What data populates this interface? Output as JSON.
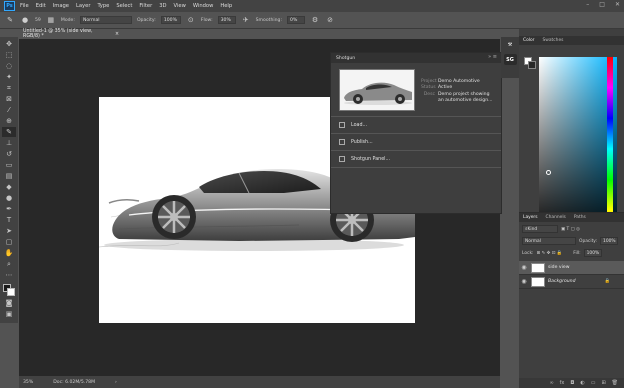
{
  "app": {
    "logo_text": "Ps"
  },
  "menu": [
    "File",
    "Edit",
    "Image",
    "Layer",
    "Type",
    "Select",
    "Filter",
    "3D",
    "View",
    "Window",
    "Help"
  ],
  "window_controls": {
    "minimize": "–",
    "maximize": "□",
    "close": "✕"
  },
  "options_bar": {
    "brush_size": "59",
    "mode_label": "Mode:",
    "mode_value": "Normal",
    "opacity_label": "Opacity:",
    "opacity_value": "100%",
    "flow_label": "Flow:",
    "flow_value": "30%",
    "smoothing_label": "Smoothing:",
    "smoothing_value": "0%"
  },
  "document": {
    "tab_title": "Untitled-1 @ 35% (side view, RGB/8) *",
    "tab_close": "×",
    "zoom": "35%",
    "doc_info": "Doc: 6.02M/5.78M"
  },
  "shotgun_panel": {
    "title": "Shotgun",
    "project_label": "Project",
    "project_value": "Demo Automotive",
    "status_label": "Status",
    "status_value": "Active",
    "desc_label": "Desc",
    "desc_value_1": "Demo project showing",
    "desc_value_2": "an automotive design...",
    "actions": [
      "Load...",
      "Publish...",
      "Shotgun Panel..."
    ]
  },
  "icon_strip": {
    "shotgun_button": "SG"
  },
  "color_panel": {
    "tabs": [
      "Color",
      "Swatches"
    ],
    "accent": "#00b4ff"
  },
  "layers_panel": {
    "tabs": [
      "Layers",
      "Channels",
      "Paths"
    ],
    "filter_value": "Kind",
    "blend_mode": "Normal",
    "opacity_label": "Opacity:",
    "opacity_value": "100%",
    "lock_label": "Lock:",
    "fill_label": "Fill:",
    "fill_value": "100%",
    "layers": [
      {
        "name": "side view",
        "selected": true
      },
      {
        "name": "Background",
        "selected": false
      }
    ]
  }
}
